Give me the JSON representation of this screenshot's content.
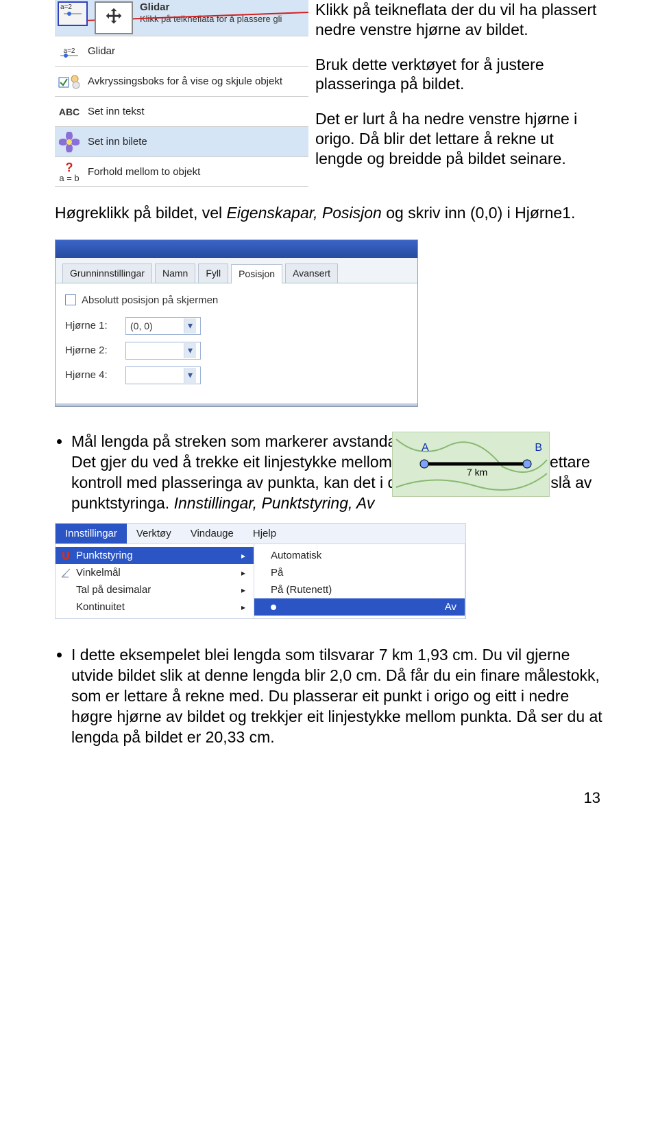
{
  "tool_panel": {
    "row0": {
      "icon_code": "a=2",
      "glidar_bold": "Glidar",
      "help": "Klikk på teikneflata for å plassere gli"
    },
    "row1": {
      "icon_code": "a=2",
      "label": "Glidar"
    },
    "row2": {
      "label": "Avkryssingsboks for å vise og skjule objekt"
    },
    "row3": {
      "abc": "ABC",
      "label": "Set inn tekst"
    },
    "row4": {
      "label": "Set inn bilete"
    },
    "row5": {
      "q": "?",
      "eq": "a = b",
      "label": "Forhold mellom to objekt"
    }
  },
  "annot": {
    "p1": "Klikk på teikneflata der du vil ha plassert nedre venstre hjørne av bildet.",
    "p2": "Bruk dette verktøyet for å justere plasseringa på bildet.",
    "p3": "Det er lurt å ha nedre venstre hjørne i origo. Då blir det lettare å rekne ut lengde og breidde på bildet seinare."
  },
  "mid1_a": "Høgreklikk på bildet, vel ",
  "mid1_b": "Eigenskapar, Posisjon",
  "mid1_c": " og skriv inn (0,0) i Hjørne1.",
  "dialog": {
    "tabs": [
      "Grunninnstillingar",
      "Namn",
      "Fyll",
      "Posisjon",
      "Avansert"
    ],
    "chk": "Absolutt posisjon på skjermen",
    "h1_lbl": "Hjørne 1:",
    "h1_val": "(0, 0)",
    "h2_lbl": "Hjørne 2:",
    "h2_val": "",
    "h4_lbl": "Hjørne 4:",
    "h4_val": ""
  },
  "bullet1_a": "Mål lengda på streken som markerer avstandar på kartet:",
  "bullet1_b": "Det gjer du ved å trekke eit linjestykke mellom endepunkta. For å få lettare kontroll med plasseringa av punkta, kan det i dette tilfellet vere lurt å slå av punktstyringa. ",
  "bullet1_c": "Innstillingar, Punktstyring, Av",
  "map": {
    "A": "A",
    "B": "B",
    "scale": "7 km"
  },
  "menu": {
    "bar": [
      "Innstillingar",
      "Verktøy",
      "Vindauge",
      "Hjelp"
    ],
    "left": [
      {
        "label": "Punktstyring",
        "hl": true,
        "icon": "c"
      },
      {
        "label": "Vinkelmål",
        "icon": "ang"
      },
      {
        "label": "Tal på desimalar"
      },
      {
        "label": "Kontinuitet"
      }
    ],
    "right": [
      "Automatisk",
      "På",
      "På (Rutenett)",
      "Av"
    ],
    "right_hl_index": 3
  },
  "bullet2": "I dette eksempelet blei lengda som tilsvarar 7 km 1,93 cm. Du vil gjerne utvide bildet slik at denne lengda blir 2,0 cm. Då får du ein finare målestokk, som er lettare å rekne med. Du plasserar eit punkt i origo og eitt i nedre høgre hjørne av bildet og trekkjer eit linjestykke mellom punkta. Då ser du at lengda på bildet er 20,33 cm.",
  "page_num": "13"
}
